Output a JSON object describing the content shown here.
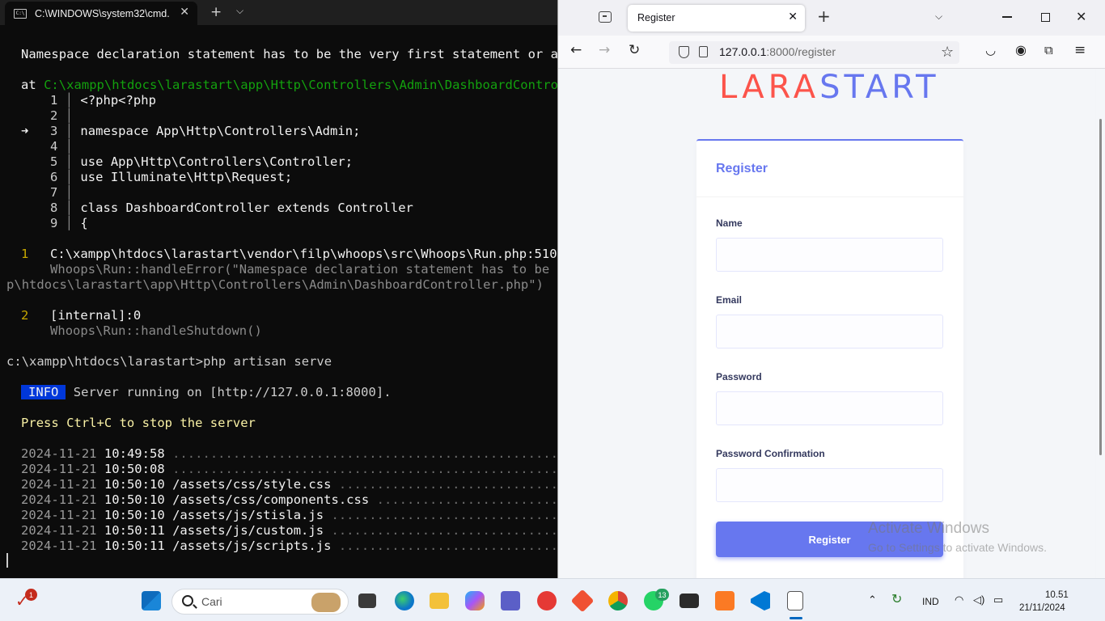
{
  "terminal": {
    "tab_title": "C:\\WINDOWS\\system32\\cmd.",
    "tab_icon": "cmd-icon",
    "error_message": "Namespace declaration statement has to be the very first statement or afte",
    "at_label": "at",
    "at_path": "C:\\xampp\\htdocs\\larastart\\app\\Http\\Controllers\\Admin\\DashboardControlle",
    "arrow": "➜",
    "code_lines": [
      {
        "num": "1",
        "code": "<?php<?php"
      },
      {
        "num": "2",
        "code": ""
      },
      {
        "num": "3",
        "code": "namespace App\\Http\\Controllers\\Admin;"
      },
      {
        "num": "4",
        "code": ""
      },
      {
        "num": "5",
        "code": "use App\\Http\\Controllers\\Controller;"
      },
      {
        "num": "6",
        "code": "use Illuminate\\Http\\Request;"
      },
      {
        "num": "7",
        "code": ""
      },
      {
        "num": "8",
        "code": "class DashboardController extends Controller"
      },
      {
        "num": "9",
        "code": "{"
      }
    ],
    "frames": [
      {
        "num": "1",
        "location": "C:\\xampp\\htdocs\\larastart\\vendor\\filp\\whoops\\src\\Whoops\\Run.php:510",
        "call": "Whoops\\Run::handleError(\"Namespace declaration statement has to be the",
        "call_cont": "p\\htdocs\\larastart\\app\\Http\\Controllers\\Admin\\DashboardController.php\")"
      },
      {
        "num": "2",
        "location": "[internal]:0",
        "call": "Whoops\\Run::handleShutdown()"
      }
    ],
    "prompt": "c:\\xampp\\htdocs\\larastart>php artisan serve",
    "info_badge": "INFO",
    "info_text": "Server running on [http://127.0.0.1:8000].",
    "stop_hint": "Press Ctrl+C to stop the server",
    "log": [
      {
        "date": "2024-11-21",
        "time": "10:49:58",
        "path": "",
        "dots": " ......................................................"
      },
      {
        "date": "2024-11-21",
        "time": "10:50:08",
        "path": "",
        "dots": " ......................................................"
      },
      {
        "date": "2024-11-21",
        "time": "10:50:10",
        "path": "/assets/css/style.css",
        "dots": " ................................"
      },
      {
        "date": "2024-11-21",
        "time": "10:50:10",
        "path": "/assets/css/components.css",
        "dots": " ..........................."
      },
      {
        "date": "2024-11-21",
        "time": "10:50:10",
        "path": "/assets/js/stisla.js",
        "dots": " ................................."
      },
      {
        "date": "2024-11-21",
        "time": "10:50:11",
        "path": "/assets/js/custom.js",
        "dots": " ................................."
      },
      {
        "date": "2024-11-21",
        "time": "10:50:11",
        "path": "/assets/js/scripts.js",
        "dots": " ................................"
      }
    ]
  },
  "browser": {
    "tab_title": "Register",
    "url_host": "127.0.0.1",
    "url_rest": ":8000/register",
    "brand_part1": "LARA",
    "brand_part2": "START",
    "brand_colors": {
      "part1": "#fc544b",
      "part2": "#6777ef"
    },
    "card_title": "Register",
    "fields": [
      {
        "label": "Name",
        "value": ""
      },
      {
        "label": "Email",
        "value": ""
      },
      {
        "label": "Password",
        "value": ""
      },
      {
        "label": "Password Confirmation",
        "value": ""
      }
    ],
    "submit_label": "Register",
    "accent_color": "#6777ef"
  },
  "watermark": {
    "title": "Activate Windows",
    "subtitle": "Go to Settings to activate Windows."
  },
  "taskbar": {
    "search_text": "Cari",
    "notification_badge": "1",
    "whatsapp_badge": "13",
    "language": "IND",
    "time": "10.51",
    "date": "21/11/2024",
    "apps": [
      "start-icon",
      "file-explorer-icon",
      "edge-icon",
      "folder-icon",
      "copilot-icon",
      "teams-icon",
      "wps-icon",
      "git-icon",
      "chrome-icon",
      "whatsapp-icon",
      "terminal-icon",
      "xampp-icon",
      "vscode-icon",
      "notepad-icon"
    ]
  }
}
